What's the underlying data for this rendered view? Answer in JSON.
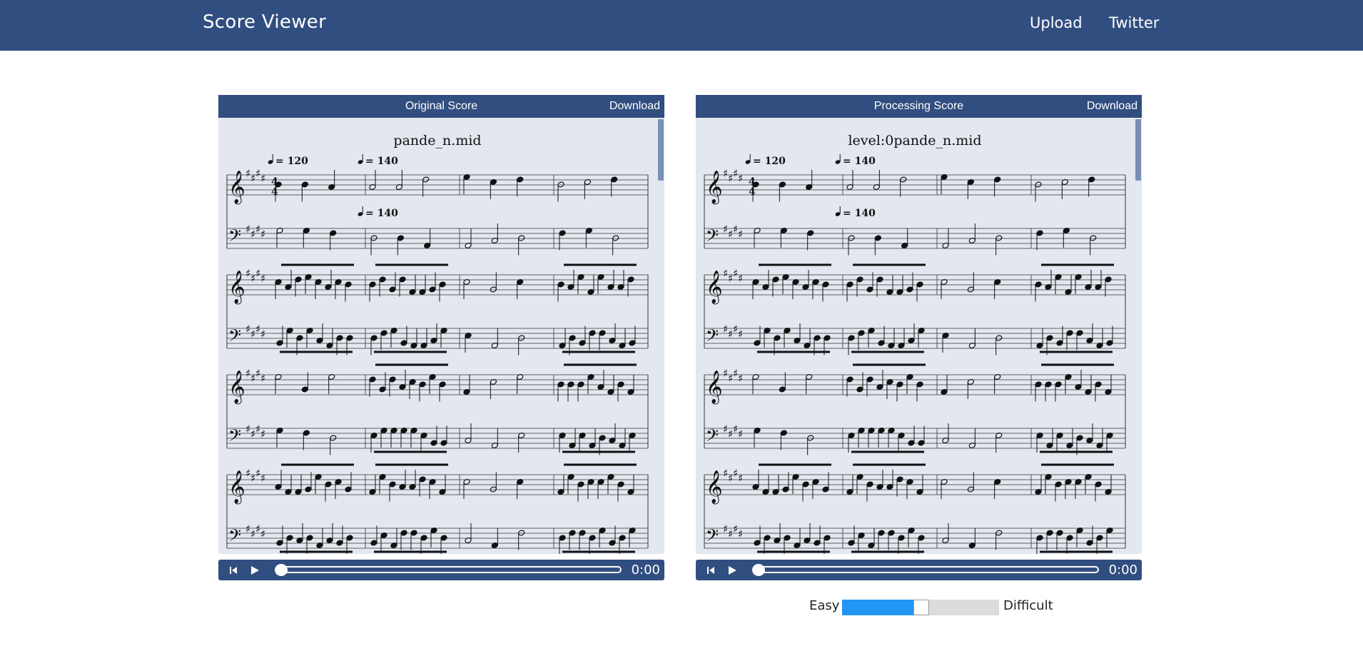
{
  "app": {
    "title": "Score Viewer",
    "nav": [
      "Upload",
      "Twitter"
    ]
  },
  "panels": [
    {
      "title": "Original Score",
      "download_label": "Download",
      "score_title": "pande_n.mid",
      "tempo_marks": [
        "= 120",
        "= 140",
        "= 140"
      ],
      "player": {
        "time": "0:00",
        "progress": 0
      }
    },
    {
      "title": "Processing Score",
      "download_label": "Download",
      "score_title": "level:0pande_n.mid",
      "tempo_marks": [
        "= 120",
        "= 140",
        "= 140"
      ],
      "player": {
        "time": "0:00",
        "progress": 0
      }
    }
  ],
  "difficulty": {
    "easy_label": "Easy",
    "difficult_label": "Difficult",
    "value": 0.5
  },
  "colors": {
    "header": "#314e80",
    "score_bg": "#e3e7ef",
    "slider_fill": "#2196f3"
  },
  "icons": {
    "skip_back": "skip-back-icon",
    "play": "play-icon"
  }
}
